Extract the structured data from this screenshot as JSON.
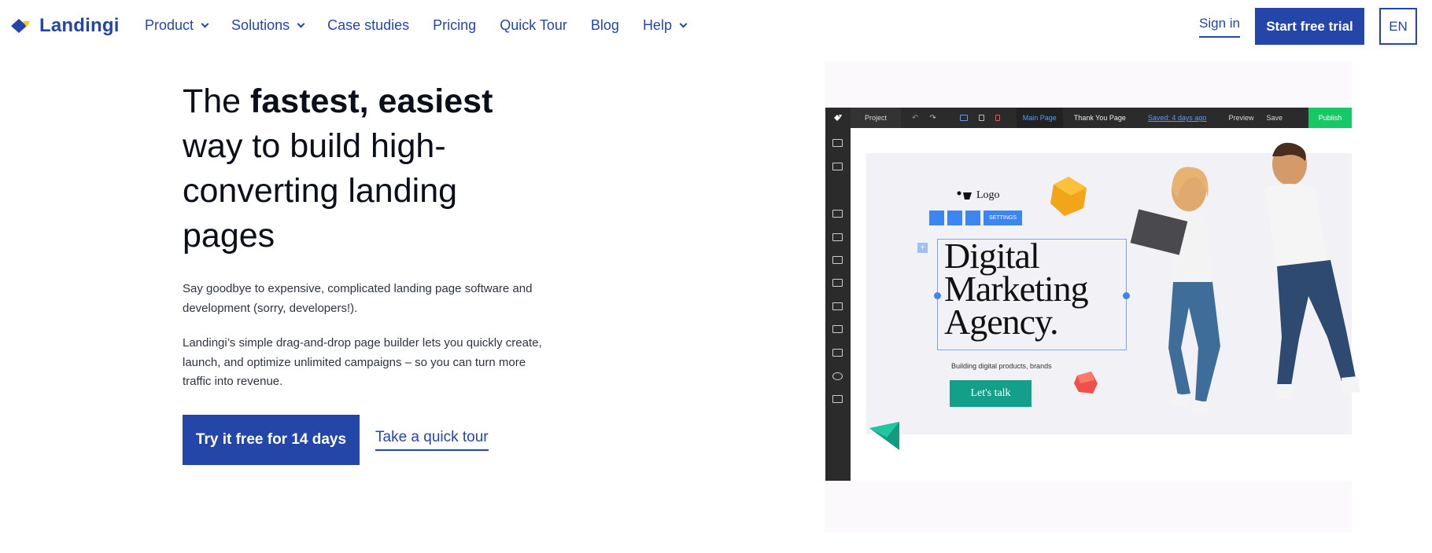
{
  "nav": {
    "brand": "Landingi",
    "items": [
      {
        "label": "Product",
        "has_dropdown": true
      },
      {
        "label": "Solutions",
        "has_dropdown": true
      },
      {
        "label": "Case studies",
        "has_dropdown": false
      },
      {
        "label": "Pricing",
        "has_dropdown": false
      },
      {
        "label": "Quick Tour",
        "has_dropdown": false
      },
      {
        "label": "Blog",
        "has_dropdown": false
      },
      {
        "label": "Help",
        "has_dropdown": true
      }
    ],
    "sign_in": "Sign in",
    "cta": "Start free trial",
    "language": "EN"
  },
  "hero": {
    "headline_1": "The ",
    "headline_bold": "fastest, easiest",
    "headline_2": " way to build high-converting landing pages",
    "paragraph_1": "Say goodbye to expensive, complicated landing page software and development (sorry, developers!).",
    "paragraph_2": "Landingi’s simple drag-and-drop page builder lets you quickly create, launch, and optimize unlimited campaigns – so you can turn more traffic into revenue.",
    "primary_cta": "Try it free for 14 days",
    "secondary_cta": "Take a quick tour"
  },
  "editor_mockup": {
    "project_label": "Project",
    "page_tabs": [
      "Main Page",
      "Thank You Page"
    ],
    "saved_status": "Saved: 4 days ago",
    "preview": "Preview",
    "save": "Save",
    "publish": "Publish",
    "settings_label": "SETTINGS",
    "canvas_logo": "Logo",
    "canvas_heading_lines": [
      "Digital",
      "Marketing",
      "Agency."
    ],
    "canvas_subtitle": "Building digital products, brands",
    "canvas_button": "Let's talk"
  },
  "colors": {
    "brand_blue": "#2346a8",
    "accent_yellow": "#ffcc00",
    "editor_dark": "#2b2b2b",
    "publish_green": "#17c964",
    "canvas_button": "#13a08a"
  }
}
